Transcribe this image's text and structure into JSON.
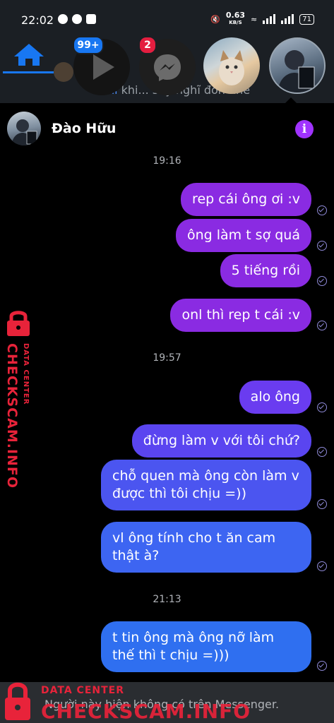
{
  "status_bar": {
    "time": "22:02",
    "net_speed": "0.63",
    "net_unit": "KB/S",
    "battery": "71"
  },
  "background": {
    "name_highlight": "Nhi",
    "snippet_rest": " khi... suy nghĩ đơn nhé",
    "dots": "...."
  },
  "badges": {
    "video_count": "99+",
    "messenger_count": "2"
  },
  "chat": {
    "name": "Đào Hữu",
    "info_symbol": "i"
  },
  "messages": [
    {
      "time": "19:16"
    },
    {
      "text": "rep cái ông ơi :v",
      "color": "#8a2be2"
    },
    {
      "text": "ông làm t sợ quá",
      "color": "#8a2be2"
    },
    {
      "text": "5 tiếng rồi",
      "color": "#8a2be2"
    },
    {
      "text": "onl thì rep t cái :v",
      "color": "#8a2be2"
    },
    {
      "time": "19:57"
    },
    {
      "text": "alo ông",
      "color": "#6a3cf0"
    },
    {
      "text": "đừng làm v với tôi chứ?",
      "color": "#5a45f0"
    },
    {
      "text": "chỗ quen mà ông còn làm v được thì tôi chịu =))",
      "color": "#4b55f0"
    },
    {
      "text": "vl ông tính cho t ăn cam thật à?",
      "color": "#3d65f2"
    },
    {
      "time": "21:13"
    },
    {
      "text": "t tin ông mà ông nỡ làm thế thì t chịu =)))",
      "color": "#2f6ff0"
    }
  ],
  "footer": {
    "text": "Người này hiện không có trên Messenger."
  },
  "watermark": {
    "main": "CHECKSCAM.INFO",
    "sub": "DATA CENTER"
  },
  "colors": {
    "accent_purple": "#8a2be2",
    "accent_blue": "#2f6ff0",
    "messenger_blue": "#1877f2",
    "watermark_red": "#e8233a"
  }
}
